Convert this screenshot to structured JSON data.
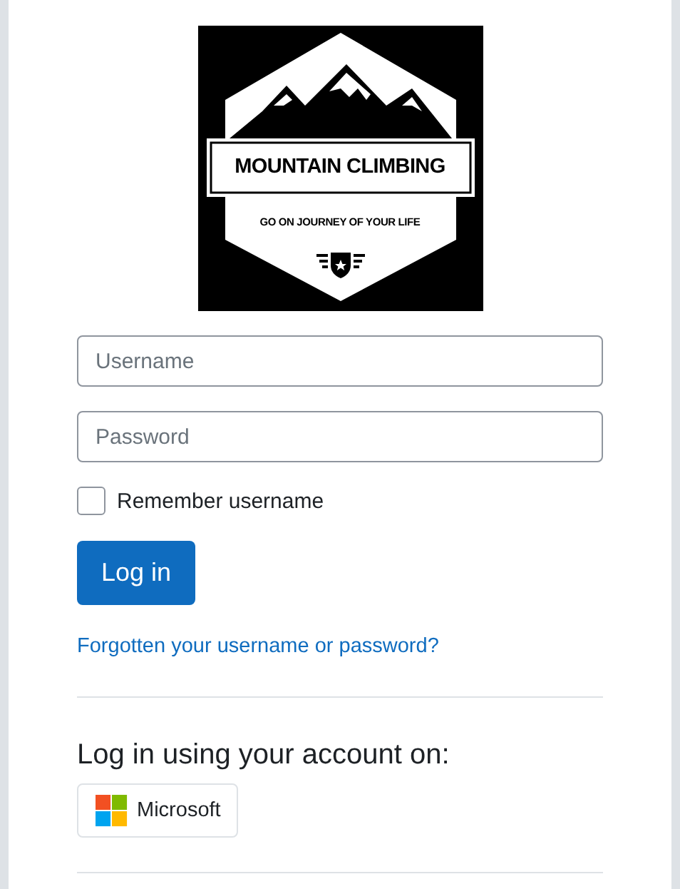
{
  "logo": {
    "title": "MOUNTAIN CLIMBING",
    "tagline": "GO ON JOURNEY OF YOUR LIFE"
  },
  "username": {
    "placeholder": "Username"
  },
  "password": {
    "placeholder": "Password"
  },
  "remember": {
    "label": "Remember username",
    "checked": false
  },
  "login_button": "Log in",
  "forgot_link": "Forgotten your username or password?",
  "sso": {
    "heading": "Log in using your account on:",
    "providers": [
      {
        "label": "Microsoft",
        "kind": "microsoft"
      }
    ]
  }
}
